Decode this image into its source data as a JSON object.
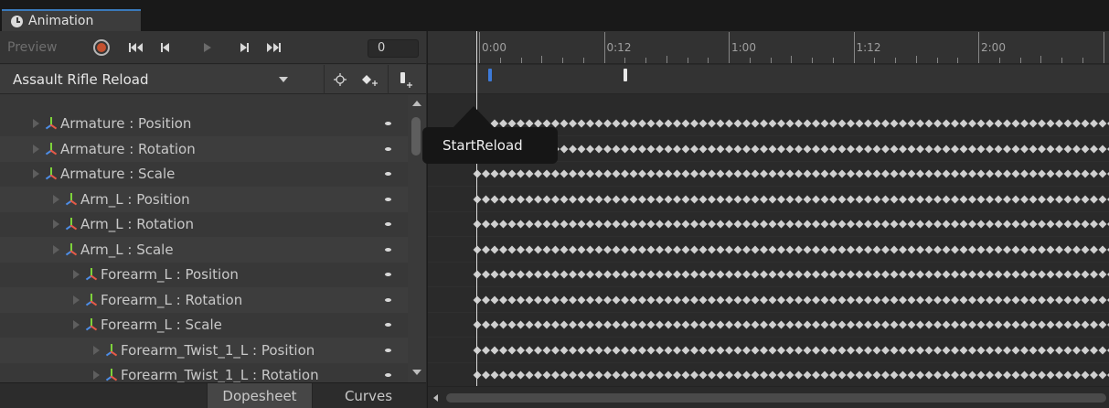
{
  "window": {
    "tab_title": "Animation",
    "accent_color": "#3a79bb"
  },
  "toolbar": {
    "preview_label": "Preview",
    "record_icon": "record-icon",
    "first_key_icon": "skip-to-start-icon",
    "prev_key_icon": "previous-key-icon",
    "play_icon": "play-icon",
    "next_key_icon": "next-key-icon",
    "last_key_icon": "skip-to-end-icon",
    "frame_value": "0"
  },
  "clip": {
    "selected": "Assault Rifle Reload",
    "tools": [
      "filter-icon",
      "add-keyframe-icon",
      "add-event-icon"
    ]
  },
  "properties": [
    {
      "label": "Armature : Position",
      "level": 0
    },
    {
      "label": "Armature : Rotation",
      "level": 0
    },
    {
      "label": "Armature : Scale",
      "level": 0
    },
    {
      "label": "Arm_L : Position",
      "level": 1
    },
    {
      "label": "Arm_L : Rotation",
      "level": 1
    },
    {
      "label": "Arm_L : Scale",
      "level": 1
    },
    {
      "label": "Forearm_L : Position",
      "level": 2
    },
    {
      "label": "Forearm_L : Rotation",
      "level": 2
    },
    {
      "label": "Forearm_L : Scale",
      "level": 2
    },
    {
      "label": "Forearm_Twist_1_L : Position",
      "level": 3
    },
    {
      "label": "Forearm_Twist_1_L : Rotation",
      "level": 3
    }
  ],
  "bottom_tabs": {
    "dopesheet": "Dopesheet",
    "curves": "Curves"
  },
  "timeline": {
    "labels": [
      "0:00",
      "0:12",
      "1:00",
      "1:12",
      "2:00"
    ],
    "event_colors": [
      "#3d7ad8",
      "#e8e8e8"
    ],
    "keyframe_color": "#cfcfcf"
  },
  "tooltip": {
    "text": "StartReload"
  }
}
